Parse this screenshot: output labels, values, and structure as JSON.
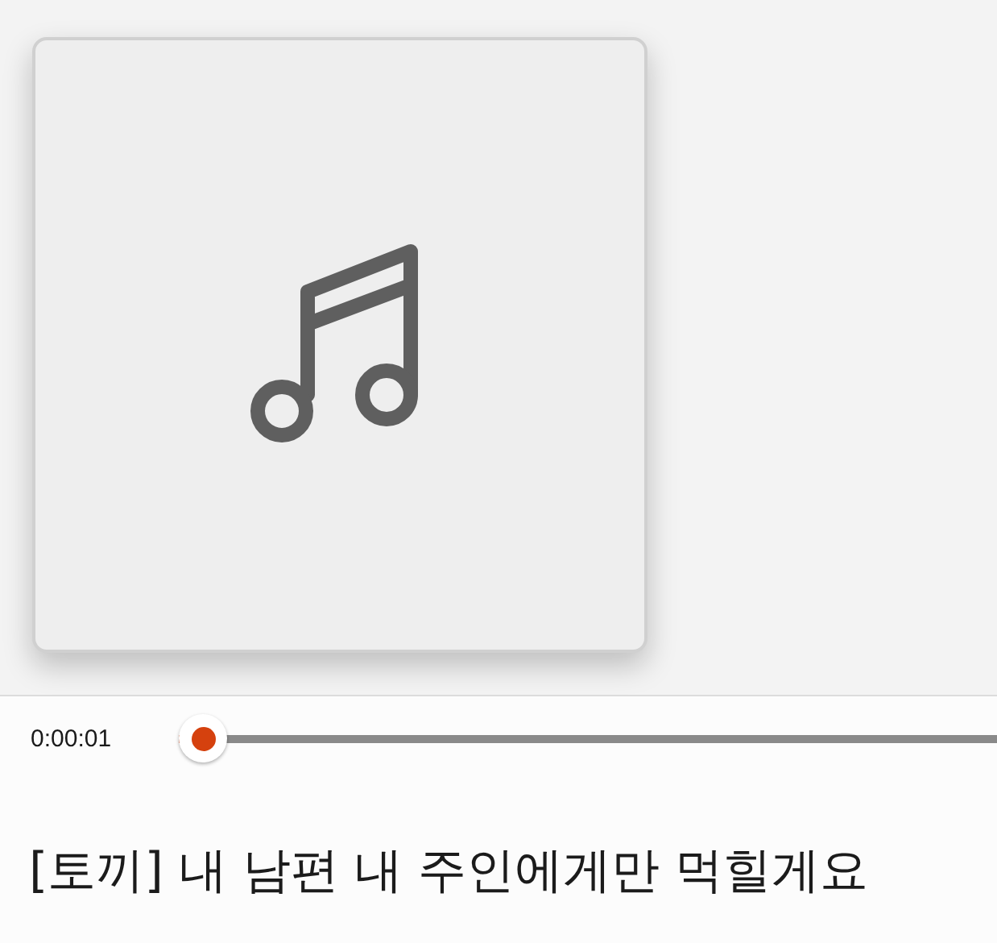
{
  "album_art": {
    "kind": "placeholder"
  },
  "player": {
    "elapsed": "0:00:01",
    "progress": {
      "level": 0.03
    }
  },
  "track_title": "[토끼] 내 남편 내 주인에게만 먹힐게요"
}
